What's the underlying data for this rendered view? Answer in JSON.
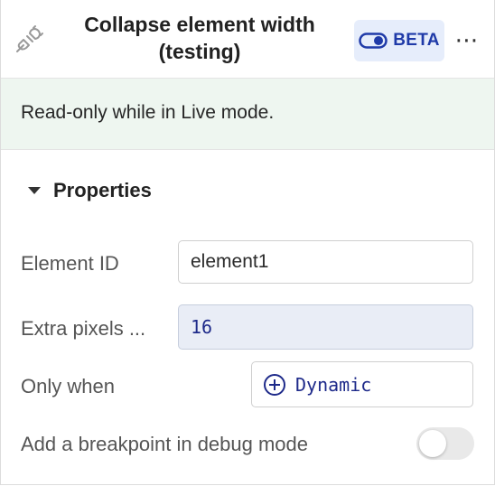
{
  "header": {
    "title_line1": "Collapse element width",
    "title_line2": "(testing)",
    "beta_label": "BETA",
    "more_label": "⋯"
  },
  "banner": {
    "text": "Read-only while in Live mode."
  },
  "properties": {
    "section_title": "Properties",
    "element_id": {
      "label": "Element ID",
      "value": "element1"
    },
    "extra_pixels": {
      "label": "Extra pixels ...",
      "value": "16"
    },
    "only_when": {
      "label": "Only when",
      "button_label": "Dynamic"
    },
    "breakpoint": {
      "label": "Add a breakpoint in debug mode",
      "enabled": false
    }
  },
  "colors": {
    "accent": "#1f3aa8",
    "banner_bg": "#eef6f0",
    "beta_bg": "#e6edfb"
  },
  "icons": [
    "plug-icon",
    "toggle-icon",
    "more-icon",
    "triangle-down-icon",
    "plus-circle-icon"
  ]
}
